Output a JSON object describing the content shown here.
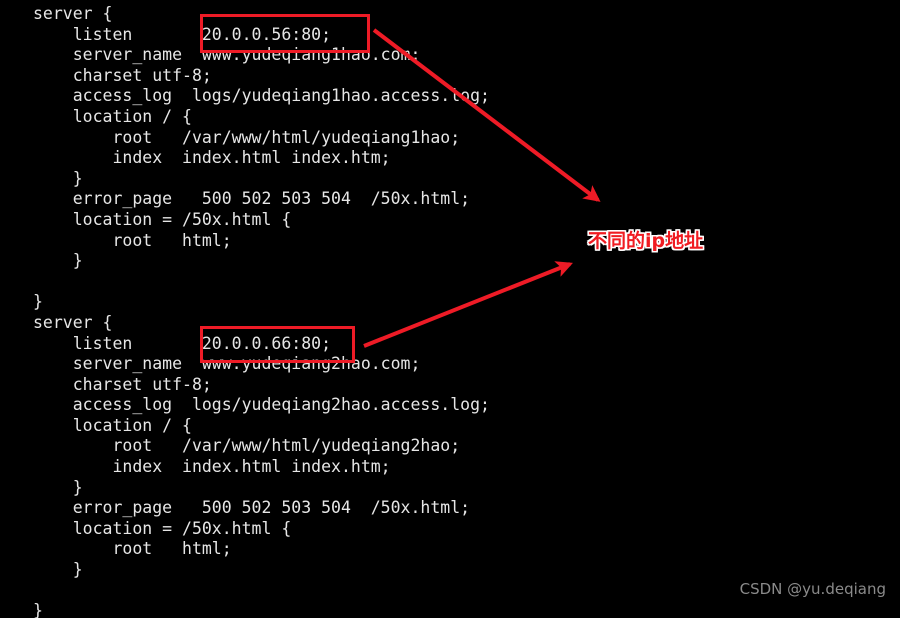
{
  "terminal": {
    "background_color": "#000000",
    "text_color": "#e6e6e6",
    "lines": [
      "server {",
      "    listen       20.0.0.56:80;",
      "    server_name  www.yudeqiang1hao.com;",
      "    charset utf-8;",
      "    access_log  logs/yudeqiang1hao.access.log;",
      "    location / {",
      "        root   /var/www/html/yudeqiang1hao;",
      "        index  index.html index.htm;",
      "    }",
      "    error_page   500 502 503 504  /50x.html;",
      "    location = /50x.html {",
      "        root   html;",
      "    }",
      "",
      "}",
      "server {",
      "    listen       20.0.0.66:80;",
      "    server_name  www.yudeqiang2hao.com;",
      "    charset utf-8;",
      "    access_log  logs/yudeqiang2hao.access.log;",
      "    location / {",
      "        root   /var/www/html/yudeqiang2hao;",
      "        index  index.html index.htm;",
      "    }",
      "    error_page   500 502 503 504  /50x.html;",
      "    location = /50x.html {",
      "        root   html;",
      "    }",
      "",
      "}"
    ]
  },
  "annotations": {
    "accent_color": "#ee1b26",
    "outline_color": "#ffffff",
    "label_text": "不同的ip地址",
    "highlight_1_value": "20.0.0.56:80;",
    "highlight_2_value": "20.0.0.66:80;",
    "arrow_1_label": "arrow-from-listen-56-to-label",
    "arrow_2_label": "arrow-from-listen-66-to-label"
  },
  "watermark": {
    "text": "CSDN @yu.deqiang",
    "color": "#8a8a8a"
  }
}
